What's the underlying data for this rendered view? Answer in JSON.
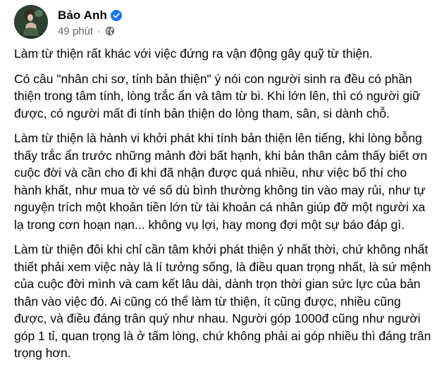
{
  "post": {
    "author": "Bảo Anh",
    "time": "49 phút",
    "separator": "·",
    "privacy_icon": "globe-icon",
    "verified_icon": "verified-badge-icon",
    "paragraphs": [
      "Làm từ thiện rất khác với việc đứng ra vận động gây quỹ từ thiện.",
      "Có câu \"nhân chi sơ, tính bản thiện\" ý nói con người sinh ra đều có phần thiện trong tâm tính, lòng trắc ẩn và tâm từ bi. Khi lớn lên, thì có người giữ được, có người mất đi tính bản thiện do lòng tham, sân, si dành chỗ.",
      "Làm từ thiện là hành vi khởi phát khi tính bản thiện lên tiếng, khi lòng bỗng thấy trắc ẩn trước những mảnh đời bất hạnh, khi bản thân cảm thấy biết ơn cuộc đời và cần cho đi khi đã nhận được quá nhiều, như việc bố thí cho hành khất, như mua tờ vé số dù bình thường không tin vào may rủi, như tự nguyện trích một khoản tiền lớn từ tài khoản cá nhân giúp đỡ một người xa lạ trong cơn hoạn nạn... không vụ lợi, hay mong đợi một sự báo đáp gì.",
      "Làm từ thiện đôi khi chỉ cần tâm khởi phát thiện ý nhất thời, chứ không nhất thiết phải xem việc này là lí tưởng sống, là điều quan trọng nhất, là sứ mệnh của cuộc đời mình và cam kết lâu dài, dành trọn thời gian sức lực của bản thân vào việc đó. Ai cũng có thể làm từ thiện, ít cũng được, nhiều cũng được, và điều đáng trân quý như nhau. Người góp 1000đ cũng như người góp 1 tỉ, quan trọng là ở tấm lòng, chứ không phải ai góp nhiều thì đáng trân trọng hơn."
    ]
  },
  "colors": {
    "text": "#050505",
    "meta": "#65676b",
    "verified": "#1877f2",
    "background": "#ffffff"
  }
}
